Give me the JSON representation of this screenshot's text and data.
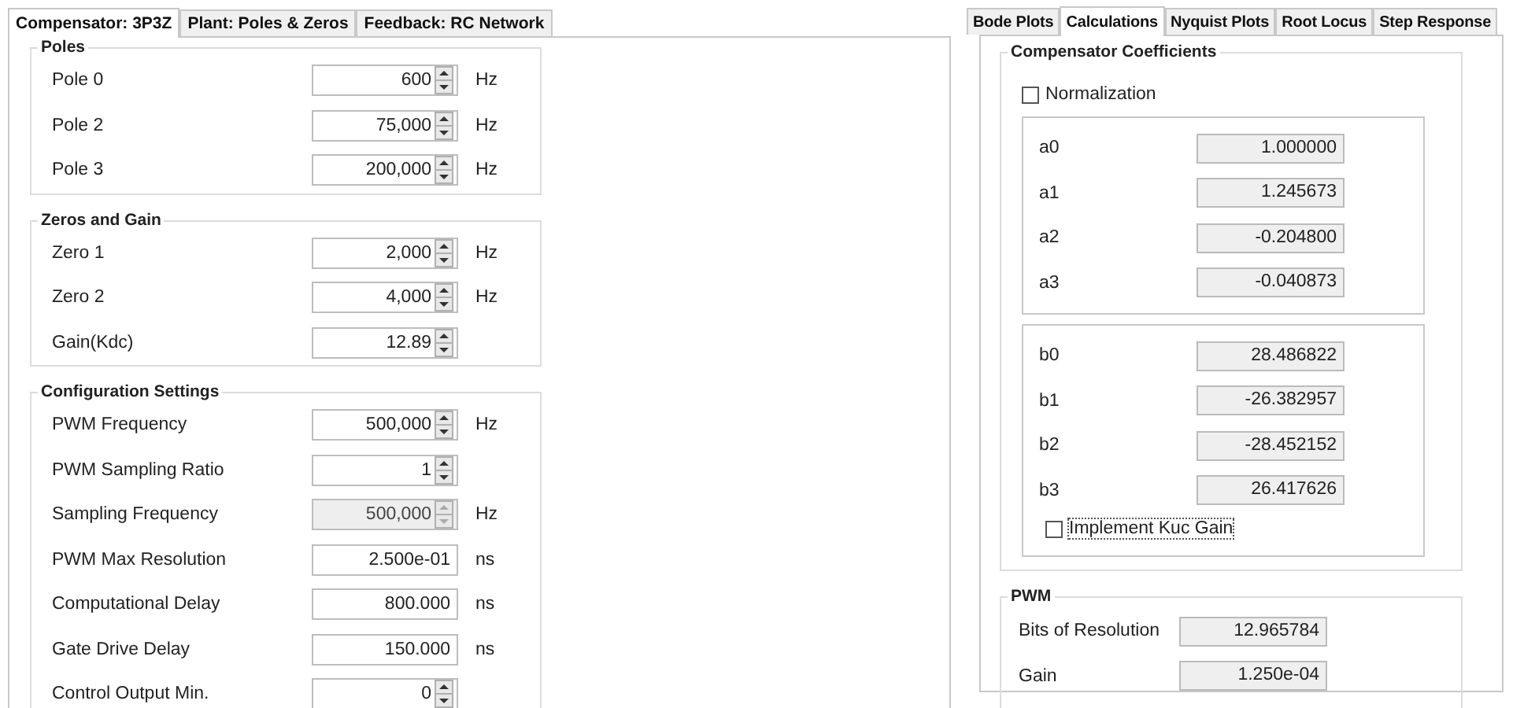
{
  "left_tabs": [
    {
      "label": "Compensator: 3P3Z",
      "selected": true
    },
    {
      "label": "Plant: Poles & Zeros",
      "selected": false
    },
    {
      "label": "Feedback: RC Network",
      "selected": false
    }
  ],
  "groups": [
    {
      "title": "Poles",
      "rows": [
        {
          "label": "Pole 0",
          "value": "600",
          "kind": "spin",
          "unit": "Hz",
          "disabled": false
        },
        {
          "label": "Pole 2",
          "value": "75,000",
          "kind": "spin",
          "unit": "Hz",
          "disabled": false
        },
        {
          "label": "Pole 3",
          "value": "200,000",
          "kind": "spin",
          "unit": "Hz",
          "disabled": false
        }
      ]
    },
    {
      "title": "Zeros and Gain",
      "rows": [
        {
          "label": "Zero 1",
          "value": "2,000",
          "kind": "spin",
          "unit": "Hz",
          "disabled": false
        },
        {
          "label": "Zero 2",
          "value": "4,000",
          "kind": "spin",
          "unit": "Hz",
          "disabled": false
        },
        {
          "label": "Gain(Kdc)",
          "value": "12.89",
          "kind": "spin",
          "disabled": false
        }
      ]
    },
    {
      "title": "Configuration Settings",
      "rows": [
        {
          "label": "PWM Frequency",
          "value": "500,000",
          "kind": "spin",
          "unit": "Hz",
          "disabled": false
        },
        {
          "label": "PWM Sampling Ratio",
          "value": "1",
          "kind": "spin",
          "disabled": false
        },
        {
          "label": "Sampling Frequency",
          "value": "500,000",
          "kind": "spin",
          "unit": "Hz",
          "disabled": true
        },
        {
          "label": "PWM Max Resolution",
          "value": "2.500e-01",
          "kind": "text",
          "unit": "ns",
          "disabled": false
        },
        {
          "label": "Computational Delay",
          "value": "800.000",
          "kind": "text",
          "unit": "ns",
          "disabled": false
        },
        {
          "label": "Gate Drive Delay",
          "value": "150.000",
          "kind": "text",
          "unit": "ns",
          "disabled": false
        },
        {
          "label": "Control Output Min.",
          "value": "0",
          "kind": "spin",
          "disabled": false
        }
      ]
    }
  ],
  "right_tabs": [
    {
      "label": "Bode Plots",
      "selected": false
    },
    {
      "label": "Calculations",
      "selected": true
    },
    {
      "label": "Nyquist Plots",
      "selected": false
    },
    {
      "label": "Root Locus",
      "selected": false
    },
    {
      "label": "Step Response",
      "selected": false
    }
  ],
  "coefficients": {
    "title": "Compensator Coefficients",
    "normalization": {
      "label": "Normalization",
      "checked": false
    },
    "a": [
      {
        "label": "a0",
        "value": "1.000000"
      },
      {
        "label": "a1",
        "value": "1.245673"
      },
      {
        "label": "a2",
        "value": "-0.204800"
      },
      {
        "label": "a3",
        "value": "-0.040873"
      }
    ],
    "b": [
      {
        "label": "b0",
        "value": "28.486822"
      },
      {
        "label": "b1",
        "value": "-26.382957"
      },
      {
        "label": "b2",
        "value": "-28.452152"
      },
      {
        "label": "b3",
        "value": "26.417626"
      }
    ],
    "implement_kuc": {
      "label": "Implement Kuc Gain",
      "checked": false
    }
  },
  "pwm": {
    "title": "PWM",
    "rows": [
      {
        "label": "Bits of Resolution",
        "value": "12.965784"
      },
      {
        "label": "Gain",
        "value": "1.250e-04"
      }
    ]
  }
}
